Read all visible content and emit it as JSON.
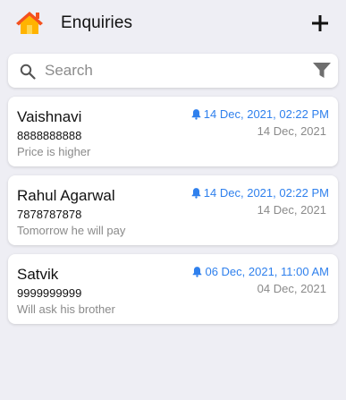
{
  "header": {
    "title": "Enquiries",
    "home_icon": "home-icon",
    "add_icon": "plus-icon",
    "home_colors": {
      "roof": "#F4511E",
      "wall": "#FFB300",
      "door": "#FFD54F"
    }
  },
  "search": {
    "placeholder": "Search",
    "value": "",
    "search_icon": "search-icon",
    "filter_icon": "filter-icon"
  },
  "colors": {
    "background": "#EEEEF4",
    "reminder_accent": "#2F80ED",
    "muted_text": "#8A8A8A"
  },
  "enquiries": [
    {
      "name": "Vaishnavi",
      "phone": "8888888888",
      "note": "Price is higher",
      "reminder": "14 Dec, 2021, 02:22 PM",
      "created": "14 Dec, 2021"
    },
    {
      "name": "Rahul Agarwal",
      "phone": "7878787878",
      "note": "Tomorrow he will pay",
      "reminder": "14 Dec, 2021, 02:22 PM",
      "created": "14 Dec, 2021"
    },
    {
      "name": "Satvik",
      "phone": "9999999999",
      "note": "Will ask his brother",
      "reminder": "06 Dec, 2021, 11:00 AM",
      "created": "04 Dec, 2021"
    }
  ]
}
